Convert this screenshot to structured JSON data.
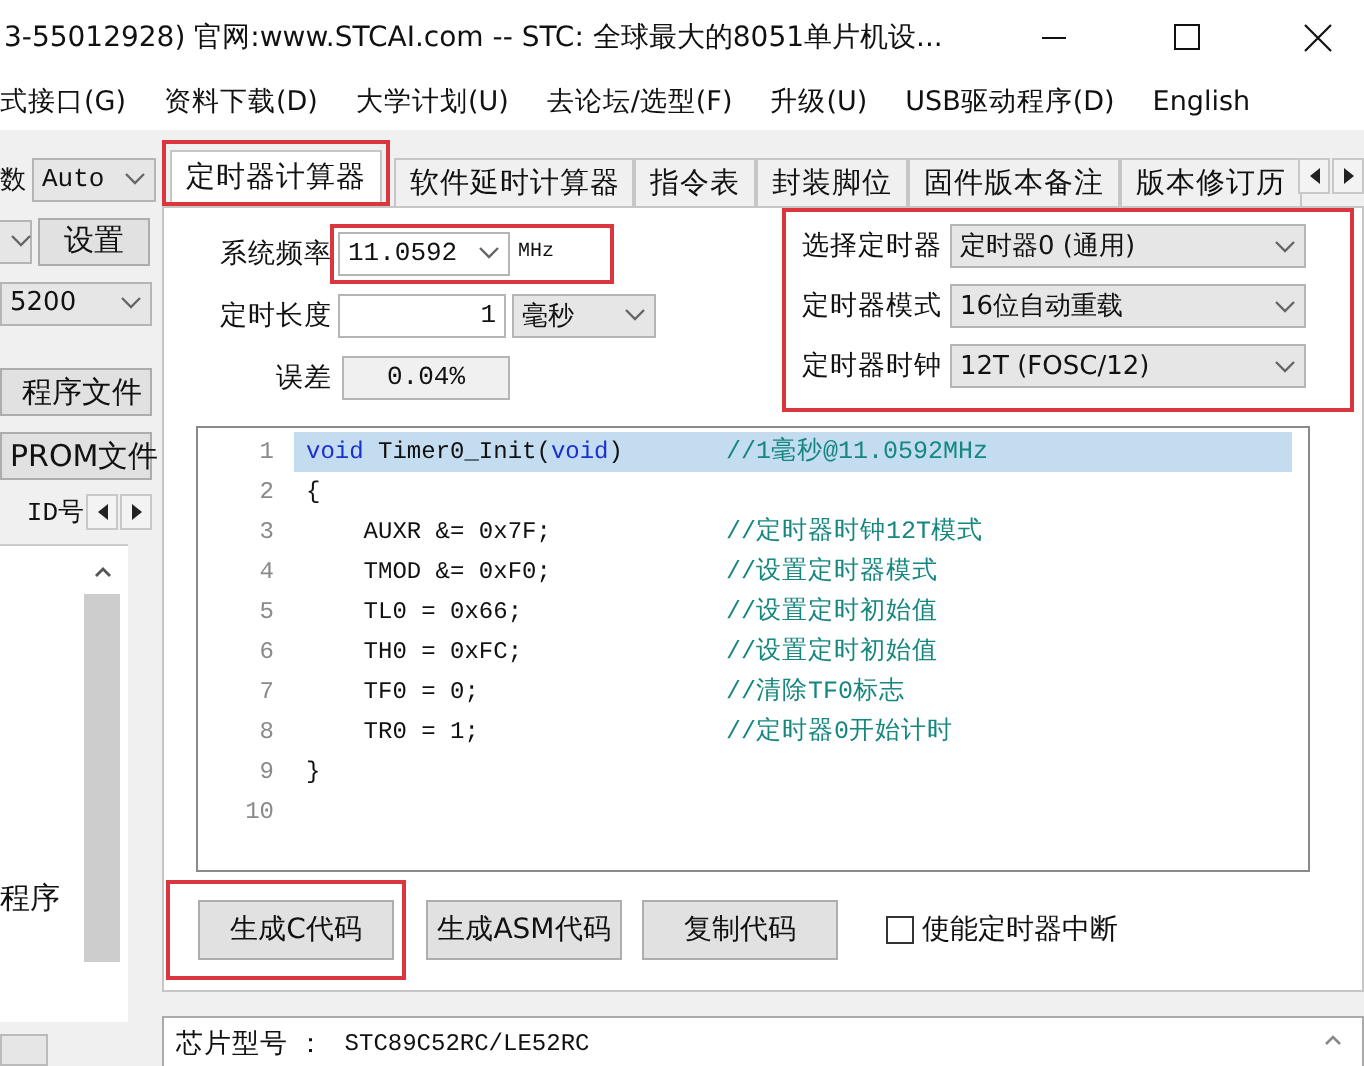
{
  "title_bar": {
    "title": "3-55012928) 官网:www.STCAI.com  -- STC: 全球最大的8051单片机设..."
  },
  "menu": [
    "式接口(G)",
    "资料下载(D)",
    "大学计划(U)",
    "去论坛/选型(F)",
    "升级(U)",
    "USB驱动程序(D)",
    "English"
  ],
  "left_panel": {
    "count_label": "数",
    "count_select": "Auto",
    "settings_button": "设置",
    "baud_select": "5200",
    "program_button": "程序文件",
    "eeprom_button": "PROM文件",
    "id_label": "ID号",
    "list_text": "程序"
  },
  "tabs": [
    {
      "label": "定时器计算器",
      "selected": true,
      "highlighted": true
    },
    {
      "label": "软件延时计算器",
      "selected": false,
      "highlighted": false
    },
    {
      "label": "指令表",
      "selected": false,
      "highlighted": false
    },
    {
      "label": "封装脚位",
      "selected": false,
      "highlighted": false
    },
    {
      "label": "固件版本备注",
      "selected": false,
      "highlighted": false
    },
    {
      "label": "版本修订历",
      "selected": false,
      "highlighted": false
    }
  ],
  "timer_form": {
    "freq_label": "系统频率",
    "freq_value": "11.0592",
    "freq_unit": "MHz",
    "freq_highlighted": true,
    "length_label": "定时长度",
    "length_value": "1",
    "length_unit": "毫秒",
    "error_label": "误差",
    "error_value": "0.04%",
    "selects_highlighted": true,
    "selects": [
      {
        "label": "选择定时器",
        "value": "定时器0 (通用)"
      },
      {
        "label": "定时器模式",
        "value": "16位自动重载"
      },
      {
        "label": "定时器时钟",
        "value": "12T (FOSC/12)"
      }
    ]
  },
  "code_lines": [
    {
      "number": "1",
      "highlighted": true,
      "parts": [
        {
          "kind": "keyword",
          "text": "void"
        },
        {
          "kind": "plain",
          "text": " Timer0_Init("
        },
        {
          "kind": "keyword",
          "text": "void"
        },
        {
          "kind": "plain",
          "text": ")"
        }
      ],
      "comment": "//1毫秒@11.0592MHz"
    },
    {
      "number": "2",
      "highlighted": false,
      "parts": [
        {
          "kind": "plain",
          "text": "{"
        }
      ]
    },
    {
      "number": "3",
      "highlighted": false,
      "parts": [
        {
          "kind": "plain",
          "text": "    AUXR &= 0x7F;"
        }
      ],
      "comment": "//定时器时钟12T模式"
    },
    {
      "number": "4",
      "highlighted": false,
      "parts": [
        {
          "kind": "plain",
          "text": "    TMOD &= 0xF0;"
        }
      ],
      "comment": "//设置定时器模式"
    },
    {
      "number": "5",
      "highlighted": false,
      "parts": [
        {
          "kind": "plain",
          "text": "    TL0 = 0x66;"
        }
      ],
      "comment": "//设置定时初始值"
    },
    {
      "number": "6",
      "highlighted": false,
      "parts": [
        {
          "kind": "plain",
          "text": "    TH0 = 0xFC;"
        }
      ],
      "comment": "//设置定时初始值"
    },
    {
      "number": "7",
      "highlighted": false,
      "parts": [
        {
          "kind": "plain",
          "text": "    TF0 = 0;"
        }
      ],
      "comment": "//清除TF0标志"
    },
    {
      "number": "8",
      "highlighted": false,
      "parts": [
        {
          "kind": "plain",
          "text": "    TR0 = 1;"
        }
      ],
      "comment": "//定时器0开始计时"
    },
    {
      "number": "9",
      "highlighted": false,
      "parts": [
        {
          "kind": "plain",
          "text": "}"
        }
      ]
    },
    {
      "number": "10",
      "highlighted": false
    }
  ],
  "buttons": [
    {
      "label": "生成C代码",
      "highlighted": true
    },
    {
      "label": "生成ASM代码",
      "highlighted": false
    },
    {
      "label": "复制代码",
      "highlighted": false
    }
  ],
  "interrupt_checkbox": {
    "label": "使能定时器中断",
    "checked": false
  },
  "status": {
    "label": "芯片型号 ：",
    "value": "STC89C52RC/LE52RC"
  }
}
